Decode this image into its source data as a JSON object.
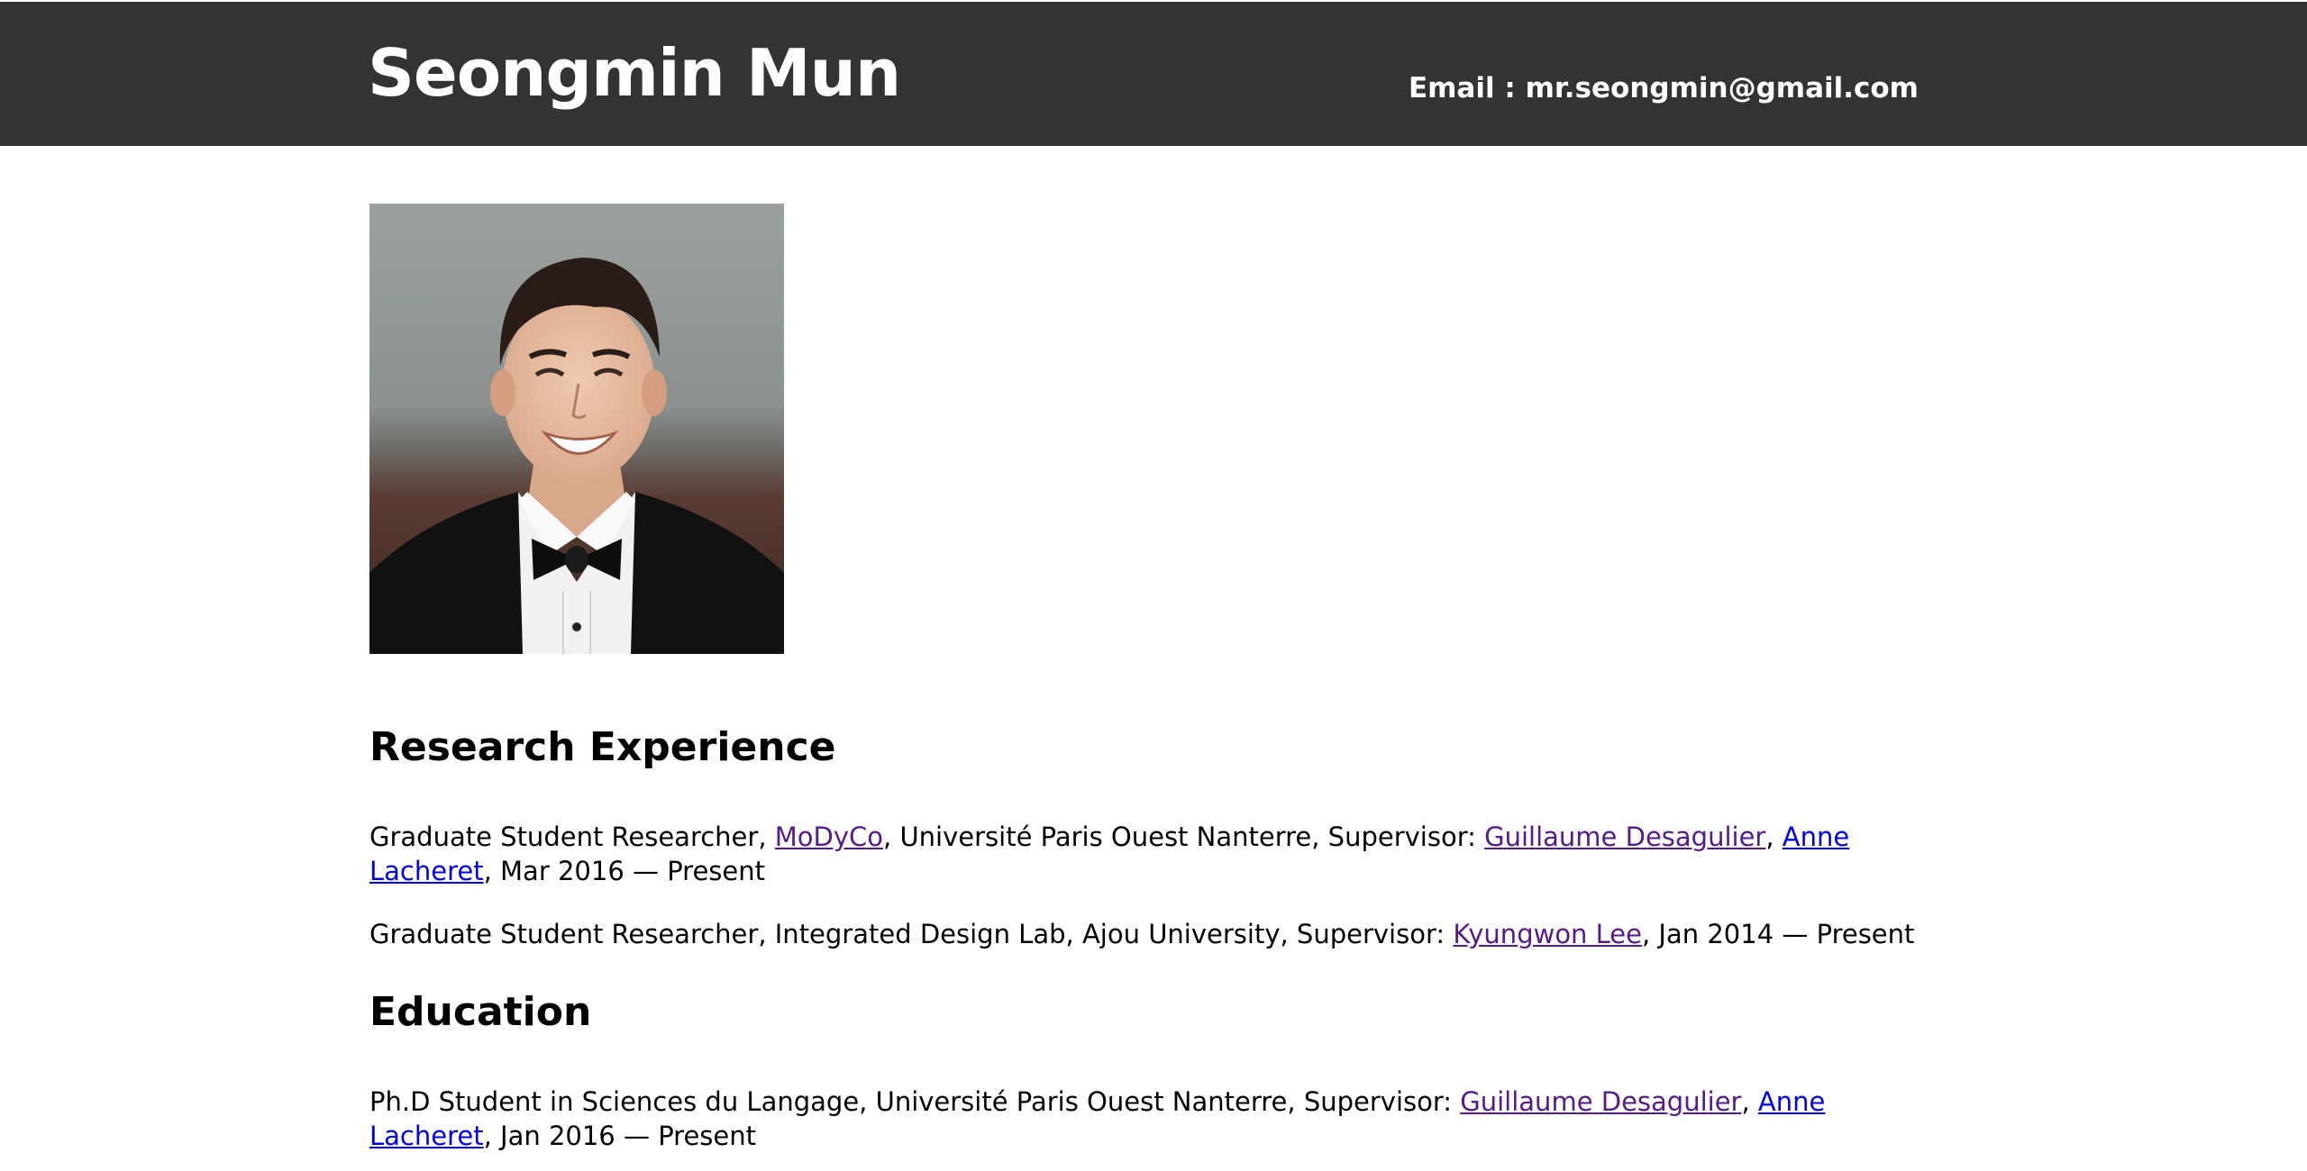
{
  "header": {
    "name": "Seongmin Mun",
    "email_label": "Email : ",
    "email_value": "mr.seongmin@gmail.com"
  },
  "colors": {
    "header_bg": "#333333",
    "link_visited": "#551a8b",
    "link_unvisited": "#0000ee"
  },
  "research": {
    "heading": "Research Experience",
    "entry1": {
      "role": "Graduate Student Researcher, ",
      "lab_link": "MoDyCo",
      "after_lab": ", Université Paris Ouest Nanterre, Supervisor: ",
      "supervisor1": "Guillaume Desagulier",
      "sep": ", ",
      "supervisor2": "Anne Lacheret",
      "period": ", Mar 2016 — Present"
    },
    "entry2": {
      "role": "Graduate Student Researcher, Integrated Design Lab, Ajou University, Supervisor: ",
      "supervisor": "Kyungwon Lee",
      "period": ", Jan 2014 — Present"
    }
  },
  "education": {
    "heading": "Education",
    "entry1": {
      "degree": "Ph.D Student in Sciences du Langage, Université Paris Ouest Nanterre, Supervisor: ",
      "supervisor1": "Guillaume Desagulier",
      "sep": ", ",
      "supervisor2": "Anne Lacheret",
      "period": ", Jan 2016 — Present"
    }
  }
}
